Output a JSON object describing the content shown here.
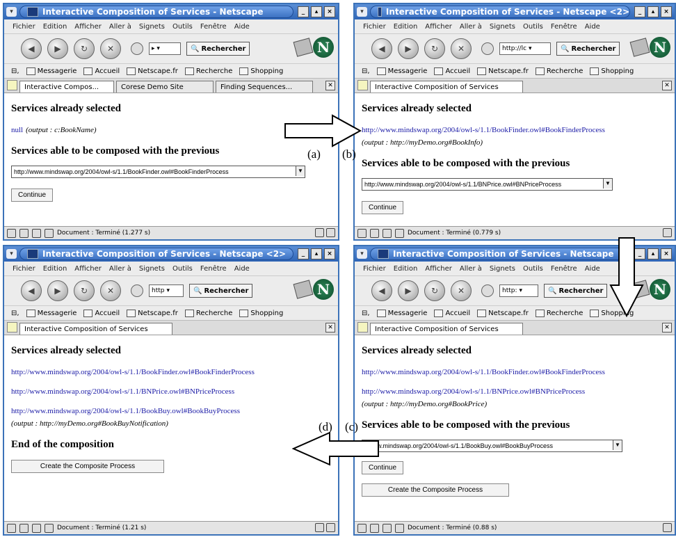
{
  "menu_items": [
    "Fichier",
    "Edition",
    "Afficher",
    "Aller à",
    "Signets",
    "Outils",
    "Fenêtre",
    "Aide"
  ],
  "search_label": "Recherche",
  "search_button": "Rechercher",
  "bookmarks": [
    "Messagerie",
    "Accueil",
    "Netscape.fr",
    "Recherche",
    "Shopping"
  ],
  "heading_selected": "Services already selected",
  "heading_able": "Services able to be composed with the previous",
  "heading_end": "End of the composition",
  "continue_label": "Continue",
  "create_label": "Create the Composite Process",
  "panel_labels": {
    "a": "(a)",
    "b": "(b)",
    "c": "(c)",
    "d": "(d)"
  },
  "windows": {
    "a": {
      "title": "Interactive Composition of Services - Netscape",
      "tabs": [
        "Interactive Compos...",
        "Corese Demo Site",
        "Finding Sequences..."
      ],
      "selected": [
        {
          "link": "null",
          "output": "(output : c:BookName)"
        }
      ],
      "select_value": "http://www.mindswap.org/2004/owl-s/1.1/BookFinder.owl#BookFinderProcess",
      "status": "Document : Terminé (1.277 s)"
    },
    "b": {
      "title": "Interactive Composition of Services - Netscape <2>",
      "url": "http://lc",
      "tabs": [
        "Interactive Composition of Services"
      ],
      "selected": [
        {
          "link": "http://www.mindswap.org/2004/owl-s/1.1/BookFinder.owl#BookFinderProcess",
          "output": "(output : http://myDemo.org#BookInfo)"
        }
      ],
      "select_value": "http://www.mindswap.org/2004/owl-s/1.1/BNPrice.owl#BNPriceProcess",
      "status": "Document : Terminé (0.779 s)"
    },
    "c": {
      "title": "Interactive Composition of Services - Netscape",
      "url": "http:",
      "tabs": [
        "Interactive Composition of Services"
      ],
      "selected": [
        {
          "link": "http://www.mindswap.org/2004/owl-s/1.1/BookFinder.owl#BookFinderProcess",
          "output": ""
        },
        {
          "link": "http://www.mindswap.org/2004/owl-s/1.1/BNPrice.owl#BNPriceProcess",
          "output": "(output : http://myDemo.org#BookPrice)"
        }
      ],
      "select_value": "//www.mindswap.org/2004/owl-s/1.1/BookBuy.owl#BookBuyProcess",
      "status": "Document : Terminé (0.88 s)"
    },
    "d": {
      "title": "Interactive Composition of Services - Netscape <2>",
      "url": "http",
      "tabs": [
        "Interactive Composition of Services"
      ],
      "selected": [
        {
          "link": "http://www.mindswap.org/2004/owl-s/1.1/BookFinder.owl#BookFinderProcess",
          "output": ""
        },
        {
          "link": "http://www.mindswap.org/2004/owl-s/1.1/BNPrice.owl#BNPriceProcess",
          "output": ""
        },
        {
          "link": "http://www.mindswap.org/2004/owl-s/1.1/BookBuy.owl#BookBuyProcess",
          "output": "(output : http://myDemo.org#BookBuyNotification)"
        }
      ],
      "status": "Document : Terminé (1.21 s)"
    }
  }
}
